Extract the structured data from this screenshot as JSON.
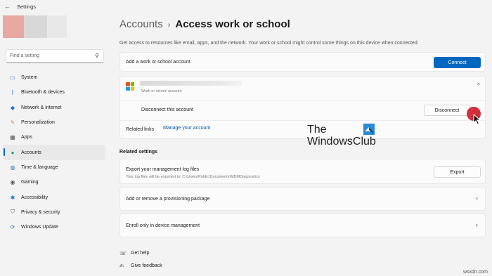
{
  "window": {
    "title": "Settings",
    "back_glyph": "←"
  },
  "sidebar": {
    "search_placeholder": "Find a setting",
    "items": [
      {
        "label": "System",
        "icon": "monitor-icon",
        "glyph": "▭",
        "color": "#1f6fd1"
      },
      {
        "label": "Bluetooth & devices",
        "icon": "bluetooth-icon",
        "glyph": "ᛒ",
        "color": "#1f6fd1"
      },
      {
        "label": "Network & internet",
        "icon": "wifi-icon",
        "glyph": "◆",
        "color": "#1f6fd1"
      },
      {
        "label": "Personalization",
        "icon": "brush-icon",
        "glyph": "✎",
        "color": "#e0883c"
      },
      {
        "label": "Apps",
        "icon": "apps-icon",
        "glyph": "▦",
        "color": "#555555"
      },
      {
        "label": "Accounts",
        "icon": "person-icon",
        "glyph": "●",
        "color": "#1f9e6e"
      },
      {
        "label": "Time & language",
        "icon": "globe-icon",
        "glyph": "◍",
        "color": "#1f6fd1"
      },
      {
        "label": "Gaming",
        "icon": "controller-icon",
        "glyph": "◉",
        "color": "#555555"
      },
      {
        "label": "Accessibility",
        "icon": "accessibility-icon",
        "glyph": "✱",
        "color": "#1f6fd1"
      },
      {
        "label": "Privacy & security",
        "icon": "shield-icon",
        "glyph": "⛉",
        "color": "#555555"
      },
      {
        "label": "Windows Update",
        "icon": "update-icon",
        "glyph": "⟳",
        "color": "#1f6fd1"
      }
    ]
  },
  "header": {
    "parent": "Accounts",
    "separator": "›",
    "current": "Access work or school"
  },
  "description": "Get access to resources like email, apps, and the network. Your work or school might control some things on this device when connected.",
  "add_account": {
    "label": "Add a work or school account",
    "button": "Connect"
  },
  "account": {
    "subtitle": "Work or school account",
    "disconnect_label": "Disconnect this account",
    "disconnect_button": "Disconnect",
    "related_links_label": "Related links",
    "manage_link": "Manage your account",
    "expanded": true
  },
  "related_settings": {
    "title": "Related settings",
    "export": {
      "label": "Export your management log files",
      "subtitle": "Your log files will be exported to: C:\\Users\\Public\\Documents\\MDMDiagnostics",
      "button": "Export"
    },
    "provisioning": {
      "label": "Add or remove a provisioning package"
    },
    "enroll": {
      "label": "Enroll only in device management"
    }
  },
  "help": {
    "get_help": "Get help",
    "give_feedback": "Give feedback"
  },
  "watermark": {
    "line1": "The",
    "line2": "WindowsClub"
  },
  "site": "wsxdn.com",
  "colors": {
    "accent": "#0067c0",
    "cursor_dot": "#d12f3a"
  }
}
